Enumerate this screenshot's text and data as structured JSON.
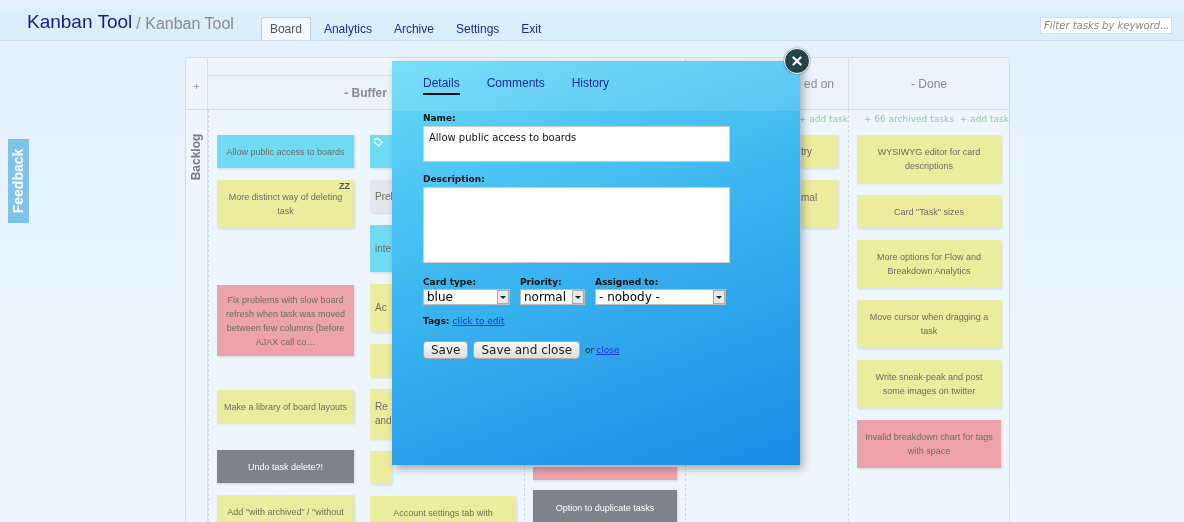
{
  "header": {
    "logo": "Kanban Tool",
    "breadcrumb": "/ Kanban Tool",
    "nav": [
      {
        "label": "Board",
        "selected": true
      },
      {
        "label": "Analytics",
        "selected": false
      },
      {
        "label": "Archive",
        "selected": false
      },
      {
        "label": "Settings",
        "selected": false
      },
      {
        "label": "Exit",
        "selected": false
      }
    ],
    "filter": {
      "placeholder": "Filter tasks by keyword..."
    }
  },
  "feedback": "Feedback",
  "board": {
    "add_lane": "+",
    "group_title": "- Buffer",
    "lane": "Backlog",
    "columns": [
      {
        "cards": [
          {
            "text": "Allow public access to boards",
            "color": "#70dcf4"
          },
          {
            "text": "More distinct way of deleting task",
            "color": "#ecec9e",
            "marker": "ZZ"
          },
          {
            "text": "Fix problems with slow board refresh when task was moved between few columns (before AJAX call co…",
            "color": "#eea2ab"
          },
          {
            "text": "Make a library of board layouts",
            "color": "#ecec9e"
          },
          {
            "text": "Undo task delete?!",
            "color": "#7d838a"
          },
          {
            "text": "Add \"with archived\" / \"without",
            "color": "#ecec9e"
          }
        ]
      },
      {
        "cards": [
          {
            "color": "#70dcf4",
            "tagged": true
          },
          {
            "text": "Prel",
            "color": "#e3e7eb",
            "tagged": false
          },
          {
            "text": "inte",
            "color": "#70dcf4",
            "tagged": false
          },
          {
            "text": "Ac",
            "color": "#ecec9e",
            "tagged": false
          },
          {
            "color": "#ecec9e",
            "tagged": false
          },
          {
            "text": "Re and",
            "color": "#ecec9e",
            "tagged": false
          },
          {
            "color": "#ecec9e",
            "tagged": false
          },
          {
            "text": "Account settings tab with",
            "color": "#ecec9e",
            "tagged": false
          }
        ]
      },
      {
        "cards": [
          {
            "color": "#eea2ab"
          },
          {
            "text": "Option to duplicate tasks",
            "color": "#7d838a"
          }
        ]
      },
      {
        "title": "ed on",
        "links": [
          "+ add task"
        ],
        "cards": [
          {
            "text": "try",
            "color": "#ecec9e"
          },
          {
            "text": "mal",
            "color": "#ecec9e"
          }
        ]
      },
      {
        "title": "- Done",
        "links": [
          "+ 66 archived tasks",
          "+ add task"
        ],
        "cards": [
          {
            "text": "WYSIWYG editor for card descriptions",
            "color": "#ecec9e"
          },
          {
            "text": "Card \"Task\" sizes",
            "color": "#ecec9e"
          },
          {
            "text": "More options for Flow and Breakdown Analytics",
            "color": "#ecec9e"
          },
          {
            "text": "Move cursor when dragging a task",
            "color": "#ecec9e"
          },
          {
            "text": "Write sneak-peak and post some images on twitter",
            "color": "#ecec9e"
          },
          {
            "text": "Invalid breakdown chart for tags with space",
            "color": "#eea2ab"
          }
        ]
      }
    ]
  },
  "dialog": {
    "tabs": [
      {
        "label": "Details",
        "selected": true
      },
      {
        "label": "Comments",
        "selected": false
      },
      {
        "label": "History",
        "selected": false
      }
    ],
    "name_label": "Name:",
    "name_value": "Allow public access to boards",
    "description_label": "Description:",
    "selects": [
      {
        "label": "Card type:",
        "value": "blue"
      },
      {
        "label": "Priority:",
        "value": "normal"
      },
      {
        "label": "Assigned to:",
        "value": "- nobody -"
      }
    ],
    "tags_label": "Tags:",
    "tags_link": "click to edit",
    "buttons": [
      "Save",
      "Save and close"
    ],
    "or": "or",
    "close_link": "close"
  }
}
